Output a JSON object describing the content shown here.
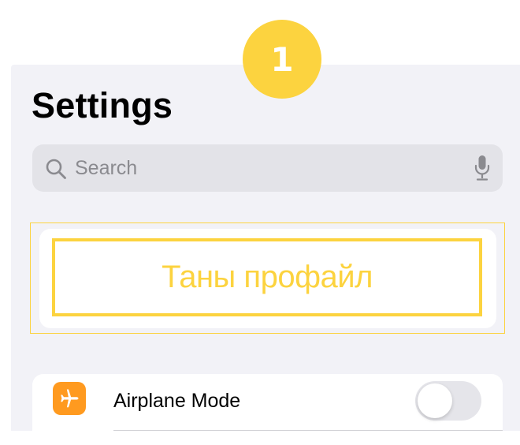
{
  "step_badge": {
    "number": "1",
    "color": "#fcd33f"
  },
  "header": {
    "title": "Settings"
  },
  "search": {
    "placeholder": "Search",
    "icon": "magnifying-glass-icon",
    "voice_icon": "microphone-icon"
  },
  "profile": {
    "label": "Таны профайл",
    "highlight_color": "#fcd33f"
  },
  "settings_rows": [
    {
      "label": "Airplane Mode",
      "icon": "airplane-icon",
      "icon_color": "#ff9a1f",
      "toggle_on": false
    }
  ],
  "colors": {
    "screen_background": "#f2f2f7",
    "search_background": "#e3e3e8",
    "accent": "#fcd33f"
  }
}
